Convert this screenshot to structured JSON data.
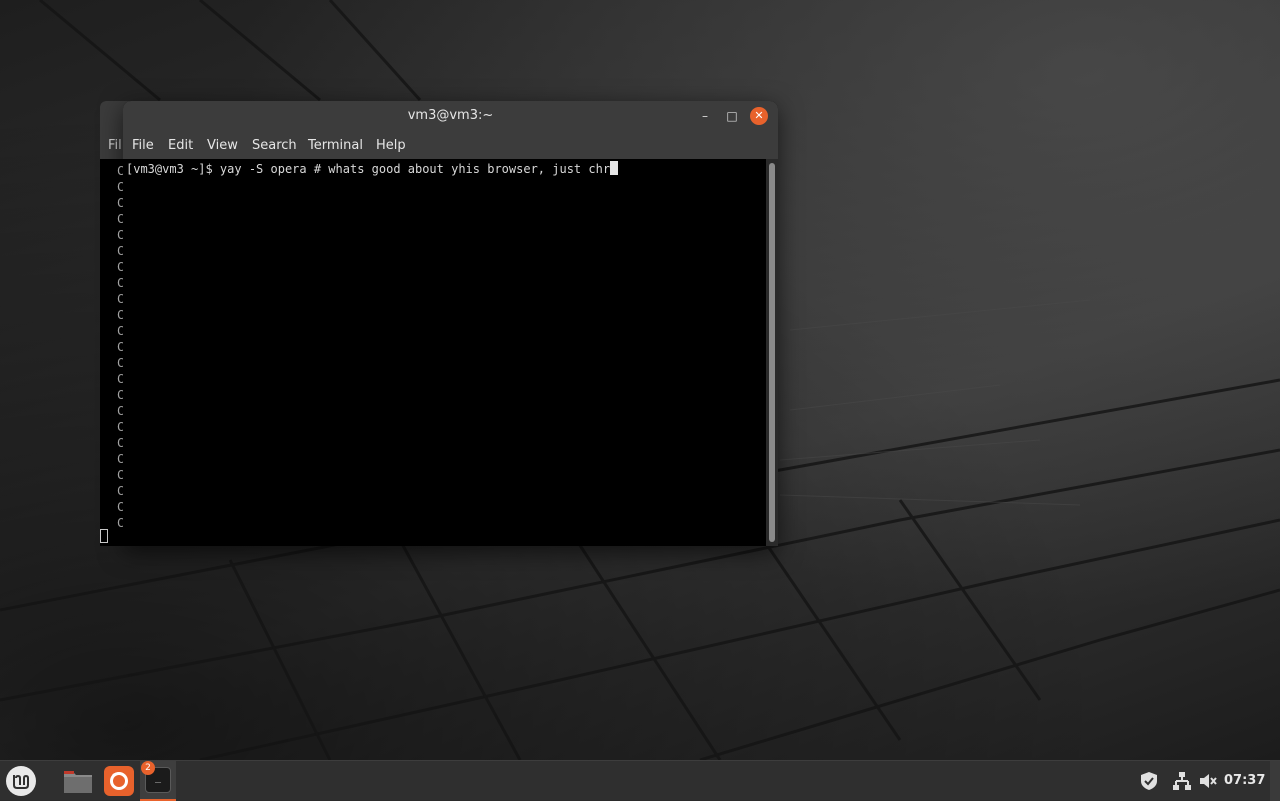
{
  "window": {
    "title": "vm3@vm3:~",
    "controls": {
      "minimize": "–",
      "maximize": "□",
      "close": "✕"
    }
  },
  "menu": [
    "File",
    "Edit",
    "View",
    "Search",
    "Terminal",
    "Help"
  ],
  "back_window": {
    "menu_fragment": "Fil",
    "line_char": "C"
  },
  "terminal": {
    "prompt": "[vm3@vm3 ~]$ ",
    "command": "yay -S opera # whats good about yhis browser, just chr"
  },
  "taskbar": {
    "terminal_badge": "2",
    "terminal_glyph": "_",
    "clock": "07:37"
  },
  "colors": {
    "accent": "#e8622c",
    "titlebar": "#3c3c3c",
    "terminal_bg": "#000000"
  }
}
